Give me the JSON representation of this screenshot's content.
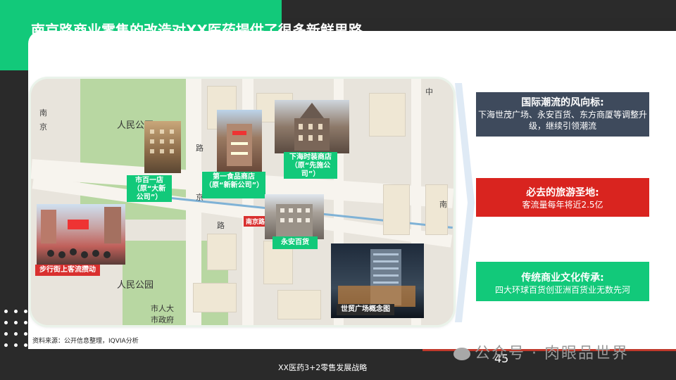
{
  "title": "南京路商业零售的改造对XX医药提供了很多新鲜思路",
  "photos": {
    "shibai": "市百一店（原“大新公司”）",
    "diyi": "第一食品商店（原“新新公司”）",
    "xiahai": "下海时装商店（原“先施公司”）",
    "yongan": "永安百货",
    "buxing": "步行街上客流攒动",
    "shimao": "世贸广场概念图"
  },
  "map_labels": {
    "renmin_park_1": "人民公园",
    "renmin_park_2": "人民公园",
    "shirenda": "市人大",
    "shizhengfu": "市政府",
    "nanjing": "南京路"
  },
  "boxes": [
    {
      "heading": "国际潮流的风向标:",
      "body": "下海世茂广场、永安百货、东方商厦等调整升级，继续引领潮流",
      "color": "#3e4a5c"
    },
    {
      "heading": "必去的旅游圣地:",
      "body": "客流量每年将近2.5亿",
      "color": "#d9241f"
    },
    {
      "heading": "传统商业文化传承:",
      "body": "四大环球百货创亚洲百货业无数先河",
      "color": "#12c97a"
    }
  ],
  "source": "资料来源：公开信息整理，IQVIA分析",
  "footer": "XX医药3+2零售发展战略",
  "page_number": "45",
  "watermark": "公众号 · 肉眼品世界"
}
